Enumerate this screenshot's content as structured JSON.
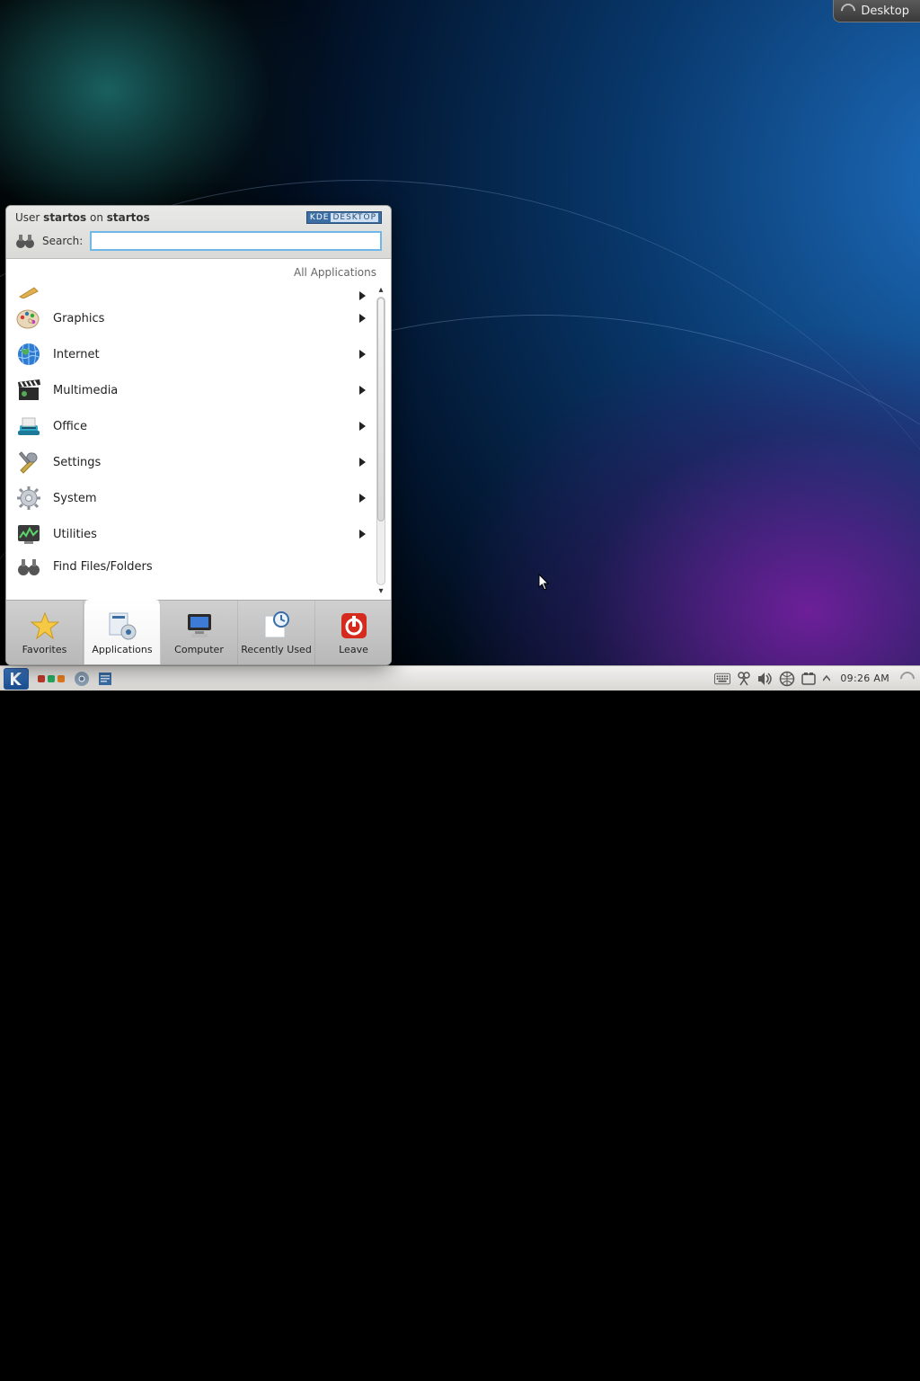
{
  "desktop_toolbox": {
    "label": "Desktop"
  },
  "kickoff": {
    "user_prefix": "User ",
    "user_name": "startos",
    "user_mid": " on ",
    "host_name": "startos",
    "kde_badge_left": "KDE",
    "kde_badge_right": "DESKTOP",
    "search_label": "Search:",
    "search_value": "",
    "breadcrumb": "All Applications",
    "categories": [
      {
        "label": "Graphics",
        "icon": "palette",
        "submenu": true
      },
      {
        "label": "Internet",
        "icon": "globe",
        "submenu": true
      },
      {
        "label": "Multimedia",
        "icon": "clapper",
        "submenu": true
      },
      {
        "label": "Office",
        "icon": "typewriter",
        "submenu": true
      },
      {
        "label": "Settings",
        "icon": "tools",
        "submenu": true
      },
      {
        "label": "System",
        "icon": "gear",
        "submenu": true
      },
      {
        "label": "Utilities",
        "icon": "monitor",
        "submenu": true
      },
      {
        "label": "Find Files/Folders",
        "icon": "binoculars",
        "submenu": false
      }
    ],
    "tabs": [
      {
        "label": "Favorites",
        "icon": "star"
      },
      {
        "label": "Applications",
        "icon": "apps"
      },
      {
        "label": "Computer",
        "icon": "computer"
      },
      {
        "label": "Recently Used",
        "icon": "recent"
      },
      {
        "label": "Leave",
        "icon": "power"
      }
    ],
    "active_tab": "Applications"
  },
  "panel": {
    "pager_colors": [
      "#c0392b",
      "#27ae60",
      "#e67e22"
    ],
    "clock": "09:26 AM"
  }
}
